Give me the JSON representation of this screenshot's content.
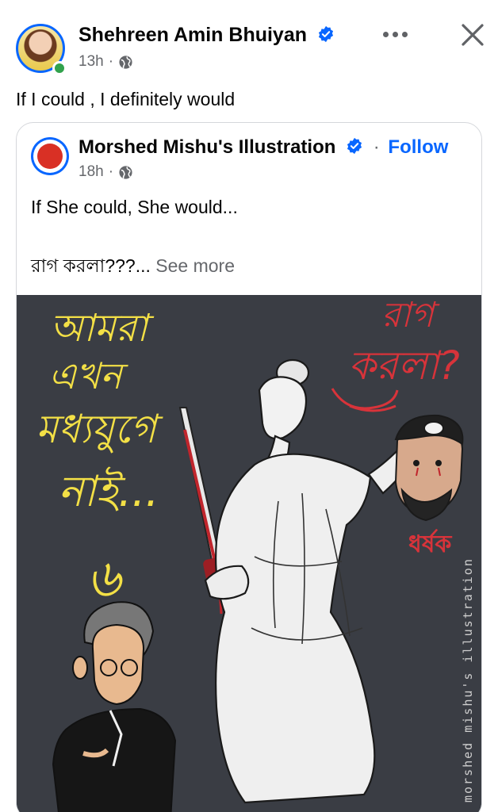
{
  "post": {
    "author_name": "Shehreen Amin Bhuiyan",
    "time": "13h",
    "separator": "·",
    "text": "If I could , I definitely would"
  },
  "shared_post": {
    "page_name": "Morshed Mishu's Illustration",
    "follow_separator": "·",
    "follow_label": "Follow",
    "time": "18h",
    "separator": "·",
    "text_line1": "If She could, She would...",
    "text_line2": "রাগ করলা???...",
    "see_more_label": "See more"
  },
  "illustration": {
    "left_caption": [
      "আমরা",
      "এখন",
      "মধ্যযুগে",
      "নাই...",
      "৬"
    ],
    "right_caption": [
      "রাগ",
      "করলা?"
    ],
    "head_label": "ধর্ষক",
    "watermark": "morshed mishu's illustration",
    "colors": {
      "background": "#3a3d44",
      "yellow": "#f3e046",
      "red": "#d8333a"
    }
  },
  "icons": {
    "verified": "verified-badge-icon",
    "globe": "globe-icon",
    "more": "more-options-icon",
    "close": "close-icon"
  },
  "colors": {
    "brand_blue": "#0866ff",
    "muted": "#65676b",
    "online": "#31a24c"
  }
}
